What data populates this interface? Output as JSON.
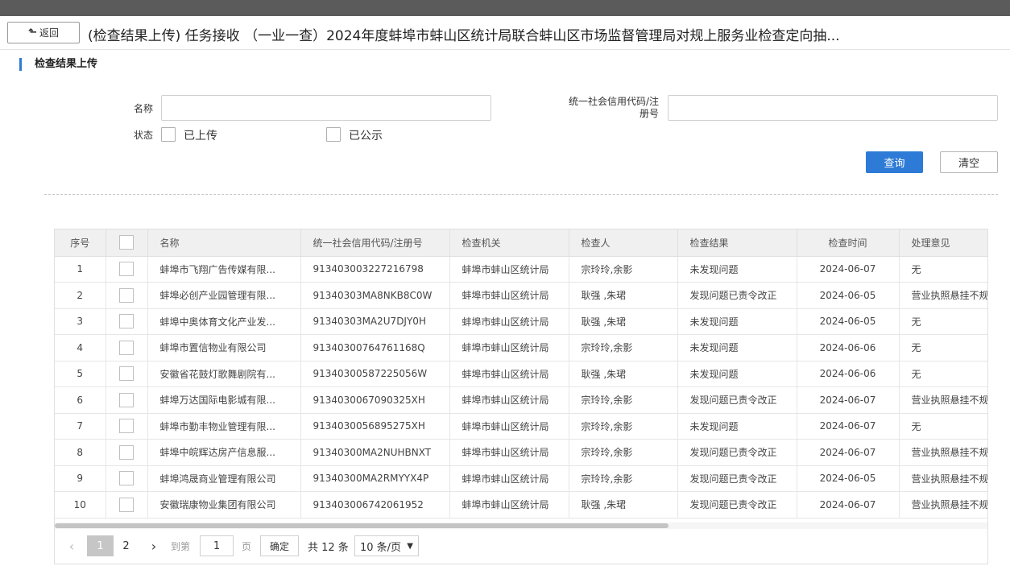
{
  "header": {
    "back_label": "返回",
    "title": "(检查结果上传) 任务接收 （一业一查）2024年度蚌埠市蚌山区统计局联合蚌山区市场监督管理局对规上服务业检查定向抽..."
  },
  "section_title": "检查结果上传",
  "filters": {
    "name_label": "名称",
    "name_value": "",
    "credit_label_line1": "统一社会信用代码/注",
    "credit_label_line2": "册号",
    "credit_value": "",
    "status_label": "状态",
    "status_options": [
      "已上传",
      "已公示"
    ],
    "query_button": "查询",
    "clear_button": "清空"
  },
  "table": {
    "columns": [
      "序号",
      "名称",
      "统一社会信用代码/注册号",
      "检查机关",
      "检查人",
      "检查结果",
      "检查时间",
      "处理意见"
    ],
    "rows": [
      [
        "1",
        "蚌埠市飞翔广告传媒有限...",
        "913403003227216798",
        "蚌埠市蚌山区统计局",
        "宗玲玲,余影",
        "未发现问题",
        "2024-06-07",
        "无"
      ],
      [
        "2",
        "蚌埠必创产业园管理有限...",
        "91340303MA8NKB8C0W",
        "蚌埠市蚌山区统计局",
        "耿强 ,朱珺",
        "发现问题已责令改正",
        "2024-06-05",
        "营业执照悬挂不规"
      ],
      [
        "3",
        "蚌埠中奥体育文化产业发...",
        "91340303MA2U7DJY0H",
        "蚌埠市蚌山区统计局",
        "耿强 ,朱珺",
        "未发现问题",
        "2024-06-05",
        "无"
      ],
      [
        "4",
        "蚌埠市置信物业有限公司",
        "91340300764761168Q",
        "蚌埠市蚌山区统计局",
        "宗玲玲,余影",
        "未发现问题",
        "2024-06-06",
        "无"
      ],
      [
        "5",
        "安徽省花鼓灯歌舞剧院有...",
        "91340300587225056W",
        "蚌埠市蚌山区统计局",
        "耿强 ,朱珺",
        "未发现问题",
        "2024-06-06",
        "无"
      ],
      [
        "6",
        "蚌埠万达国际电影城有限...",
        "9134030067090325XH",
        "蚌埠市蚌山区统计局",
        "宗玲玲,余影",
        "发现问题已责令改正",
        "2024-06-07",
        "营业执照悬挂不规"
      ],
      [
        "7",
        "蚌埠市勤丰物业管理有限...",
        "9134030056895275XH",
        "蚌埠市蚌山区统计局",
        "宗玲玲,余影",
        "未发现问题",
        "2024-06-07",
        "无"
      ],
      [
        "8",
        "蚌埠中皖辉达房产信息服...",
        "91340300MA2NUHBNXT",
        "蚌埠市蚌山区统计局",
        "宗玲玲,余影",
        "发现问题已责令改正",
        "2024-06-07",
        "营业执照悬挂不规"
      ],
      [
        "9",
        "蚌埠鸿晟商业管理有限公司",
        "91340300MA2RMYYX4P",
        "蚌埠市蚌山区统计局",
        "宗玲玲,余影",
        "发现问题已责令改正",
        "2024-06-05",
        "营业执照悬挂不规"
      ],
      [
        "10",
        "安徽瑞康物业集团有限公司",
        "913403006742061952",
        "蚌埠市蚌山区统计局",
        "耿强 ,朱珺",
        "发现问题已责令改正",
        "2024-06-07",
        "营业执照悬挂不规"
      ]
    ]
  },
  "pagination": {
    "pages": [
      "1",
      "2"
    ],
    "current_page": "1",
    "goto_label": "到第",
    "goto_value": "1",
    "page_unit": "页",
    "confirm_label": "确定",
    "total_label": "共 12 条",
    "page_size": "10 条/页"
  },
  "colors": {
    "primary": "#2d7bd6",
    "topbar": "#5b5b5b",
    "header_bg": "#f0f0f0"
  }
}
